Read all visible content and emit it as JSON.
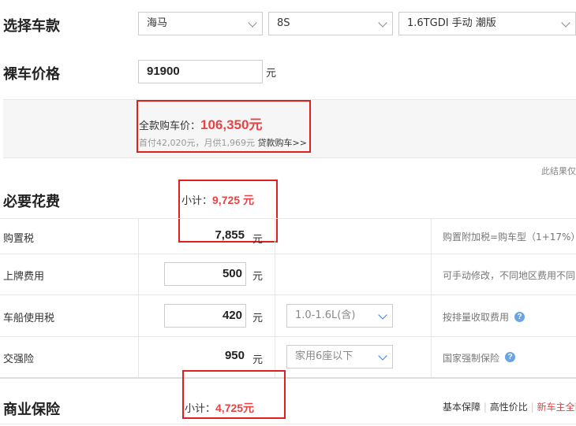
{
  "select_car": {
    "title": "选择车款",
    "brand": "海马",
    "series": "8S",
    "model": "1.6TGDI 手动 潮版"
  },
  "bare_price": {
    "title": "裸车价格",
    "value": "91900",
    "unit": "元"
  },
  "full_price": {
    "label": "全款购车价：",
    "value": "106,350元",
    "down_payment": "首付42,020元，月供1,969元",
    "loan_link": "贷款购车>>"
  },
  "result_note": "此结果仅",
  "required": {
    "title": "必要花费",
    "subtotal_label": "小计：",
    "subtotal_value": "9,725 元",
    "rows": [
      {
        "label": "购置税",
        "value": "7,855",
        "unit": "元",
        "note": "购置附加税=购车型（1+17%）"
      },
      {
        "label": "上牌费用",
        "value": "500",
        "unit": "元",
        "note": "可手动修改，不同地区费用不同"
      },
      {
        "label": "车船使用税",
        "value": "420",
        "unit": "元",
        "option": "1.0-1.6L(含)",
        "note": "按排量收取费用"
      },
      {
        "label": "交强险",
        "value": "950",
        "unit": "元",
        "option": "家用6座以下",
        "note": "国家强制保险"
      }
    ]
  },
  "commercial": {
    "title": "商业保险",
    "subtotal_label": "小计：",
    "subtotal_value": "4,725元",
    "tabs": [
      "基本保障",
      "高性价比",
      "新车主全面"
    ]
  }
}
